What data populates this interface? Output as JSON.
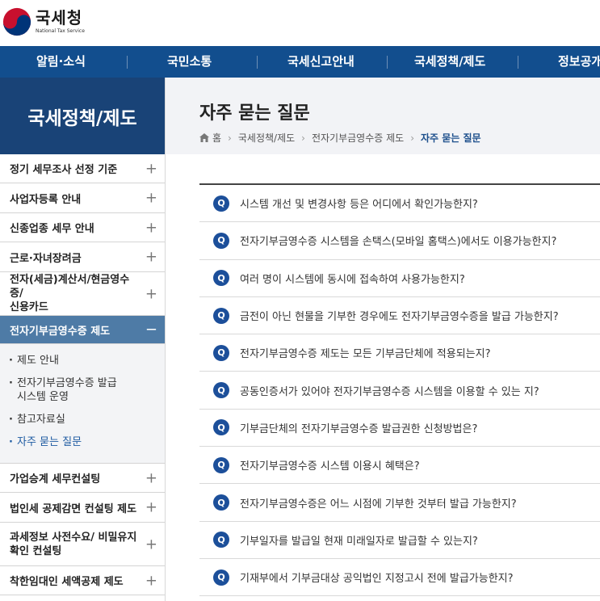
{
  "logo": {
    "name_ko": "국세청",
    "name_en": "National Tax Service"
  },
  "gnb": [
    "알림·소식",
    "국민소통",
    "국세신고안내",
    "국세정책/제도",
    "정보공개"
  ],
  "sidebar": {
    "title": "국세정책/제도",
    "items": [
      {
        "label": "정기 세무조사 선정 기준",
        "toggle": "+"
      },
      {
        "label": "사업자등록 안내",
        "toggle": "+"
      },
      {
        "label": "신종업종 세무 안내",
        "toggle": "+"
      },
      {
        "label": "근로·자녀장려금",
        "toggle": "+"
      },
      {
        "label": "전자(세금)계산서/현금영수증/\n신용카드",
        "toggle": "+"
      },
      {
        "label": "전자기부금영수증 제도",
        "toggle": "−"
      },
      {
        "label": "가업승계 세무컨설팅",
        "toggle": "+"
      },
      {
        "label": "법인세 공제감면 컨설팅 제도",
        "toggle": "+"
      },
      {
        "label": "과세정보 사전수요/ 비밀유지\n확인 컨설팅",
        "toggle": "+"
      },
      {
        "label": "착한임대인 세액공제 제도",
        "toggle": "+"
      }
    ],
    "sub_items": [
      "제도 안내",
      "전자기부금영수증 발급\n시스템 운영",
      "참고자료실",
      "자주 묻는 질문"
    ]
  },
  "page": {
    "title": "자주 묻는 질문",
    "breadcrumb": [
      "홈",
      "국세정책/제도",
      "전자기부금영수증 제도",
      "자주 묻는 질문"
    ]
  },
  "faq": {
    "badge": "Q",
    "questions": [
      "시스템 개선 및 변경사항 등은 어디에서 확인가능한지?",
      "전자기부금영수증 시스템을 손택스(모바일 홈택스)에서도 이용가능한지?",
      "여러 명이 시스템에 동시에 접속하여 사용가능한지?",
      "금전이 아닌 현물을 기부한 경우에도 전자기부금영수증을 발급 가능한지?",
      "전자기부금영수증 제도는 모든 기부금단체에 적용되는지?",
      "공동인증서가 있어야 전자기부금영수증 시스템을 이용할 수 있는 지?",
      "기부금단체의 전자기부금영수증 발급권한 신청방법은?",
      "전자기부금영수증 시스템 이용시 혜택은?",
      "전자기부금영수증은 어느 시점에 기부한 것부터 발급 가능한지?",
      "기부일자를 발급일 현재 미래일자로 발급할 수 있는지?",
      "기재부에서 기부금대상 공익법인 지정고시 전에 발급가능한지?"
    ]
  },
  "colors": {
    "gnb": "#124e8e",
    "side_title": "#194377",
    "active": "#4e7ba6",
    "badge": "#1c4f9a"
  }
}
